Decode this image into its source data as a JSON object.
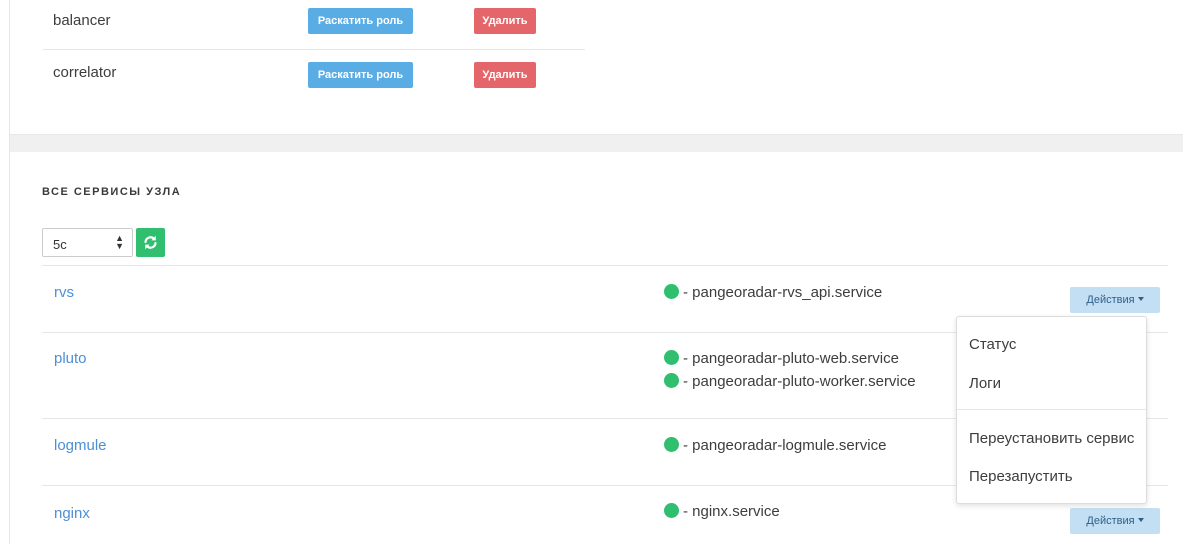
{
  "roles": [
    {
      "name": "balancer",
      "deploy_label": "Раскатить роль",
      "delete_label": "Удалить"
    },
    {
      "name": "correlator",
      "deploy_label": "Раскатить роль",
      "delete_label": "Удалить"
    }
  ],
  "services_section": {
    "title": "ВСЕ СЕРВИСЫ УЗЛА",
    "interval_value": "5с",
    "refresh_icon": "refresh-icon",
    "status_color": "#2fbf6e",
    "actions_label": "Действия",
    "rows": [
      {
        "name": "rvs",
        "units": [
          "- pangeoradar-rvs_api.service"
        ]
      },
      {
        "name": "pluto",
        "units": [
          "- pangeoradar-pluto-web.service",
          "- pangeoradar-pluto-worker.service"
        ]
      },
      {
        "name": "logmule",
        "units": [
          "- pangeoradar-logmule.service"
        ]
      },
      {
        "name": "nginx",
        "units": [
          "- nginx.service"
        ]
      }
    ]
  },
  "actions_menu": {
    "items": [
      "Статус",
      "Логи",
      "Переустановить сервис",
      "Перезапустить"
    ]
  }
}
